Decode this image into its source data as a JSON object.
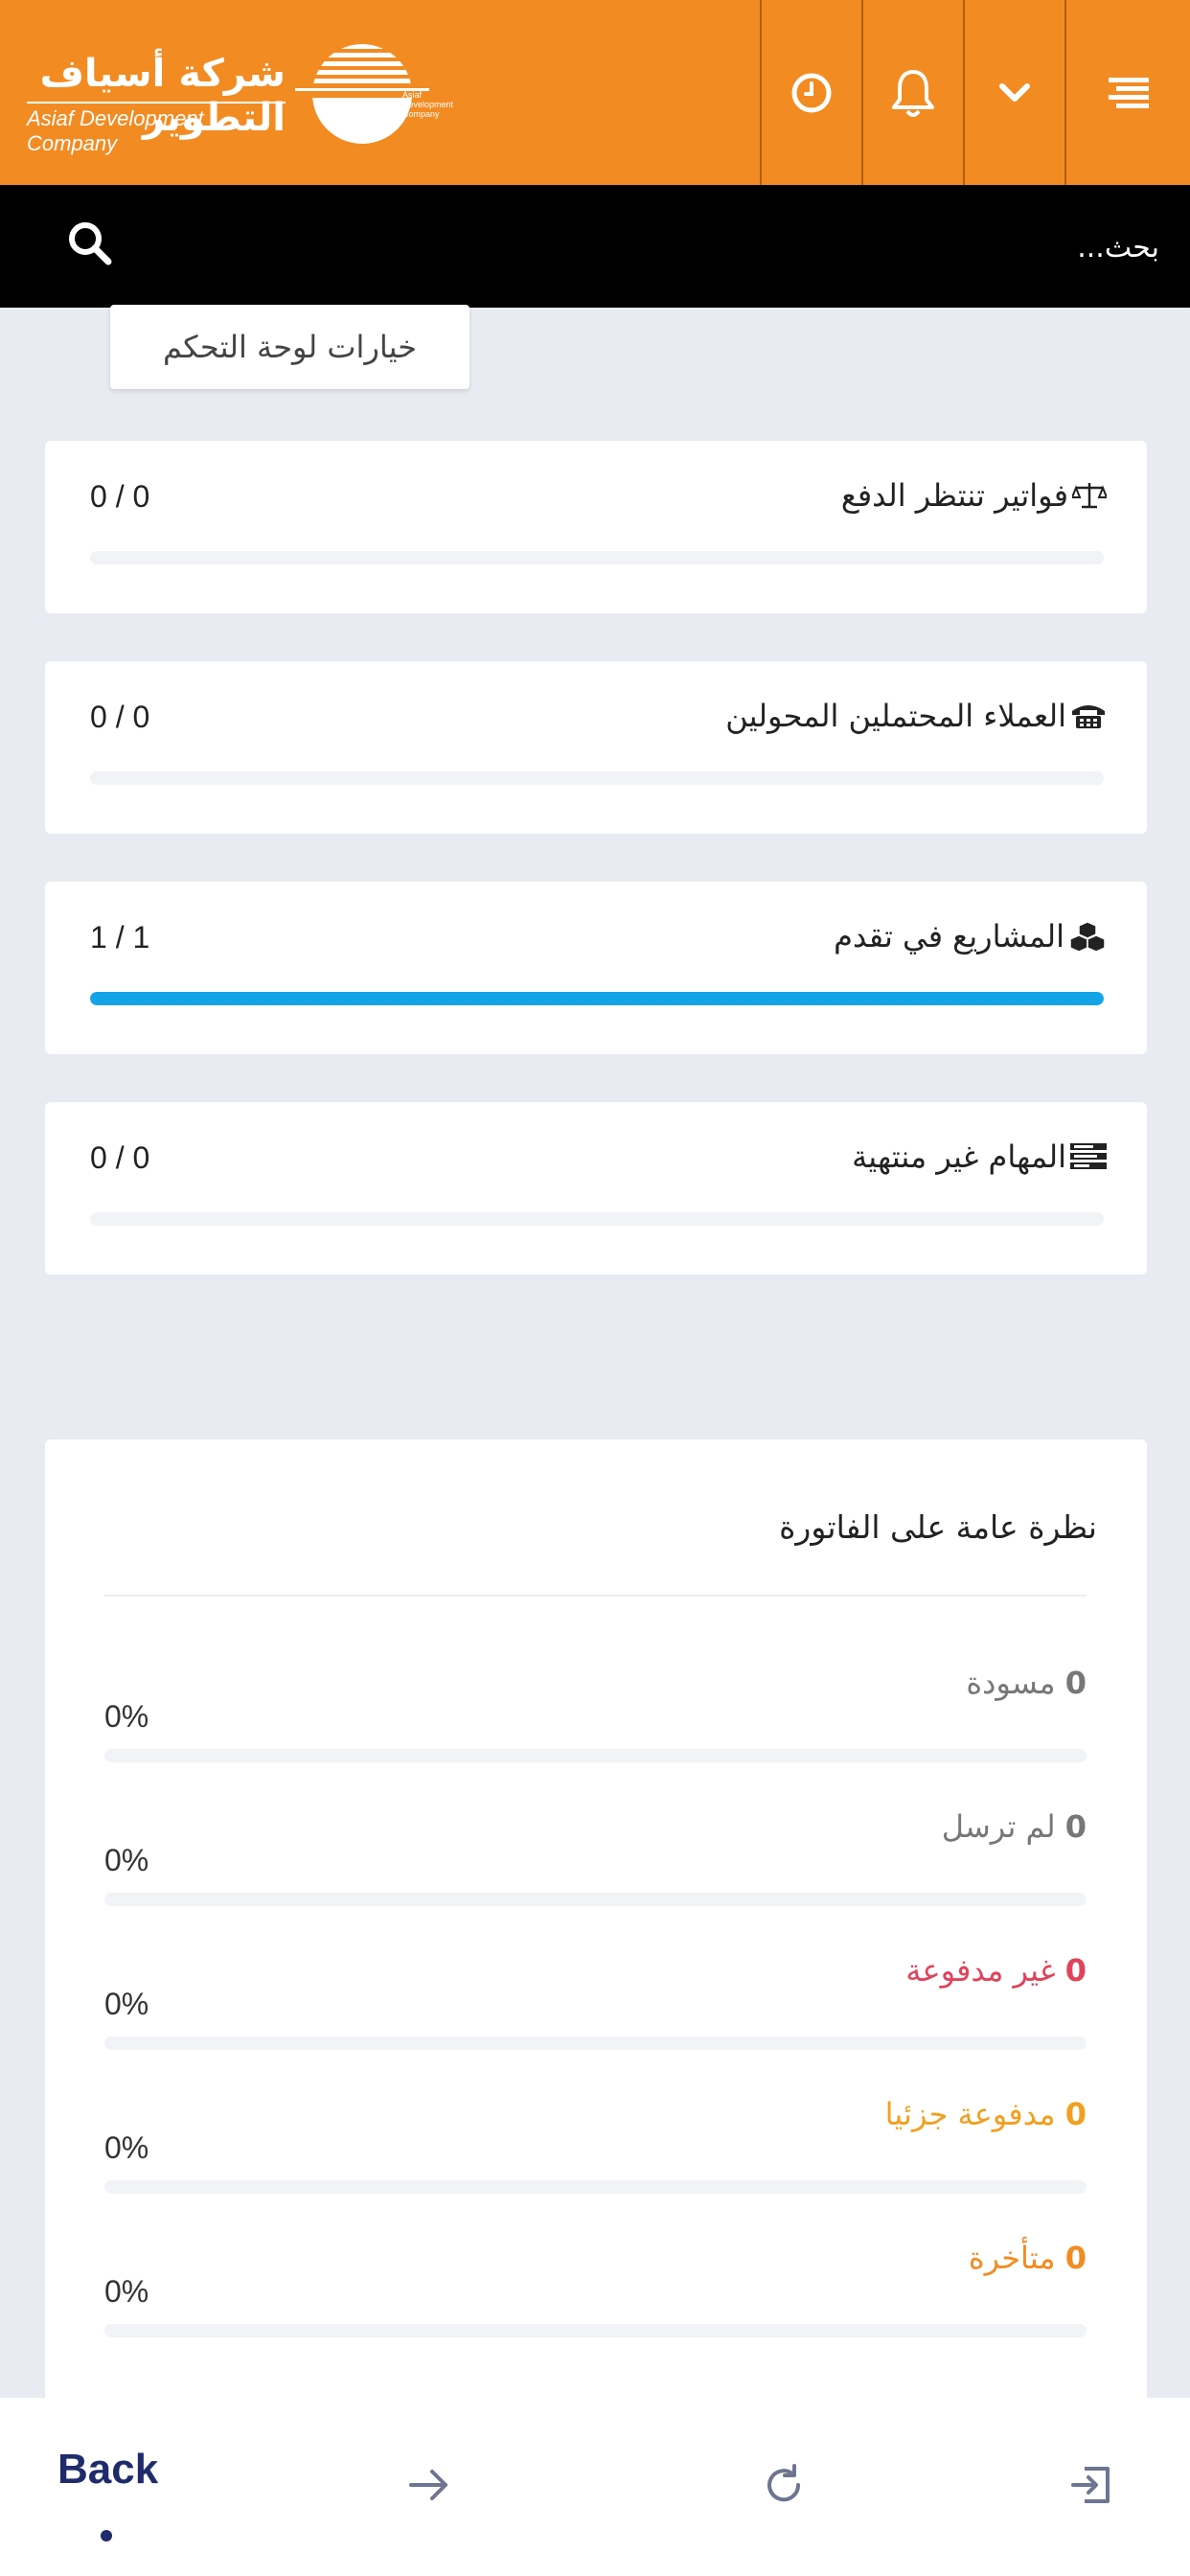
{
  "header": {
    "logo_arabic": "شركة أسياف التطوير",
    "logo_english": "Asiaf Development Company",
    "logo_mark_caption": "Asiaf Development Company",
    "buttons": [
      "menu-icon",
      "chevron-down-icon",
      "bell-icon",
      "clock-icon"
    ],
    "brand_color": "#f28b22"
  },
  "search": {
    "placeholder": "بحث..."
  },
  "dashboard_options_label": "خيارات لوحة التحكم",
  "stats": [
    {
      "title": "فواتير تنتظر الدفع",
      "icon": "balance-scale-icon",
      "count": "0 / 0",
      "progress": 0
    },
    {
      "title": "العملاء المحتملين المحولين",
      "icon": "phone-icon",
      "count": "0 / 0",
      "progress": 0
    },
    {
      "title": "المشاريع في تقدم",
      "icon": "cubes-icon",
      "count": "1 / 1",
      "progress": 1
    },
    {
      "title": "المهام غير منتهية",
      "icon": "tasks-icon",
      "count": "0 / 0",
      "progress": 0
    }
  ],
  "invoice_overview": {
    "title": "نظرة عامة على الفاتورة",
    "rows": [
      {
        "count": "0",
        "label": "مسودة",
        "percent": "0%",
        "color": "#777777"
      },
      {
        "count": "0",
        "label": "لم ترسل",
        "percent": "0%",
        "color": "#777777"
      },
      {
        "count": "0",
        "label": "غير مدفوعة",
        "percent": "0%",
        "color": "#e0435c"
      },
      {
        "count": "0",
        "label": "مدفوعة جزئيا",
        "percent": "0%",
        "color": "#f0a020"
      },
      {
        "count": "0",
        "label": "متأخرة",
        "percent": "0%",
        "color": "#f28b22"
      }
    ]
  },
  "bottom_nav": {
    "back_label": "Back",
    "icons": [
      "forward-arrow-icon",
      "refresh-icon",
      "exit-icon"
    ]
  },
  "progress_color": "#13a4e8"
}
